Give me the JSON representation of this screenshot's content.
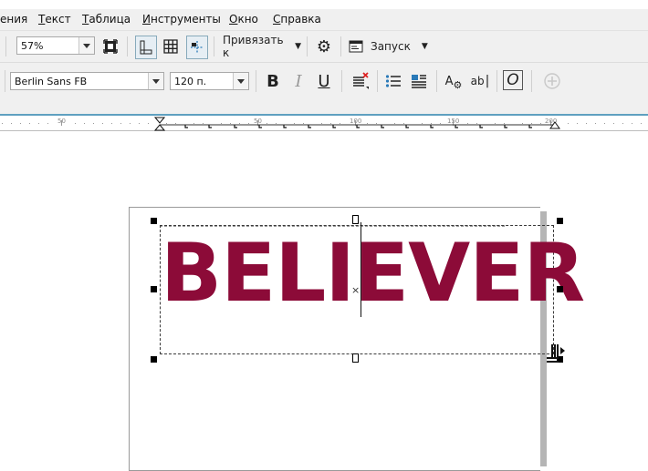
{
  "menu": {
    "items": [
      "ения",
      "Текст",
      "Таблица",
      "Инструменты",
      "Окно",
      "Справка"
    ]
  },
  "toolbar1": {
    "zoom_value": "57%",
    "snap_label": "Привязать к",
    "launch_label": "Запуск"
  },
  "toolbar2": {
    "font_name": "Berlin Sans FB",
    "font_size": "120 п.",
    "bold_label": "B",
    "italic_label": "I",
    "underline_label": "U",
    "char_format_label": "A",
    "text_edit_label": "ab",
    "opentype_label": "O"
  },
  "ruler": {
    "labels": [
      "50",
      "50",
      "100",
      "150",
      "200"
    ]
  },
  "canvas": {
    "text": "BELIEVER",
    "text_color": "#8c0b38"
  },
  "colors": {
    "chrome": "#f0f0f0",
    "ruler_accent": "#5fa0c0"
  }
}
